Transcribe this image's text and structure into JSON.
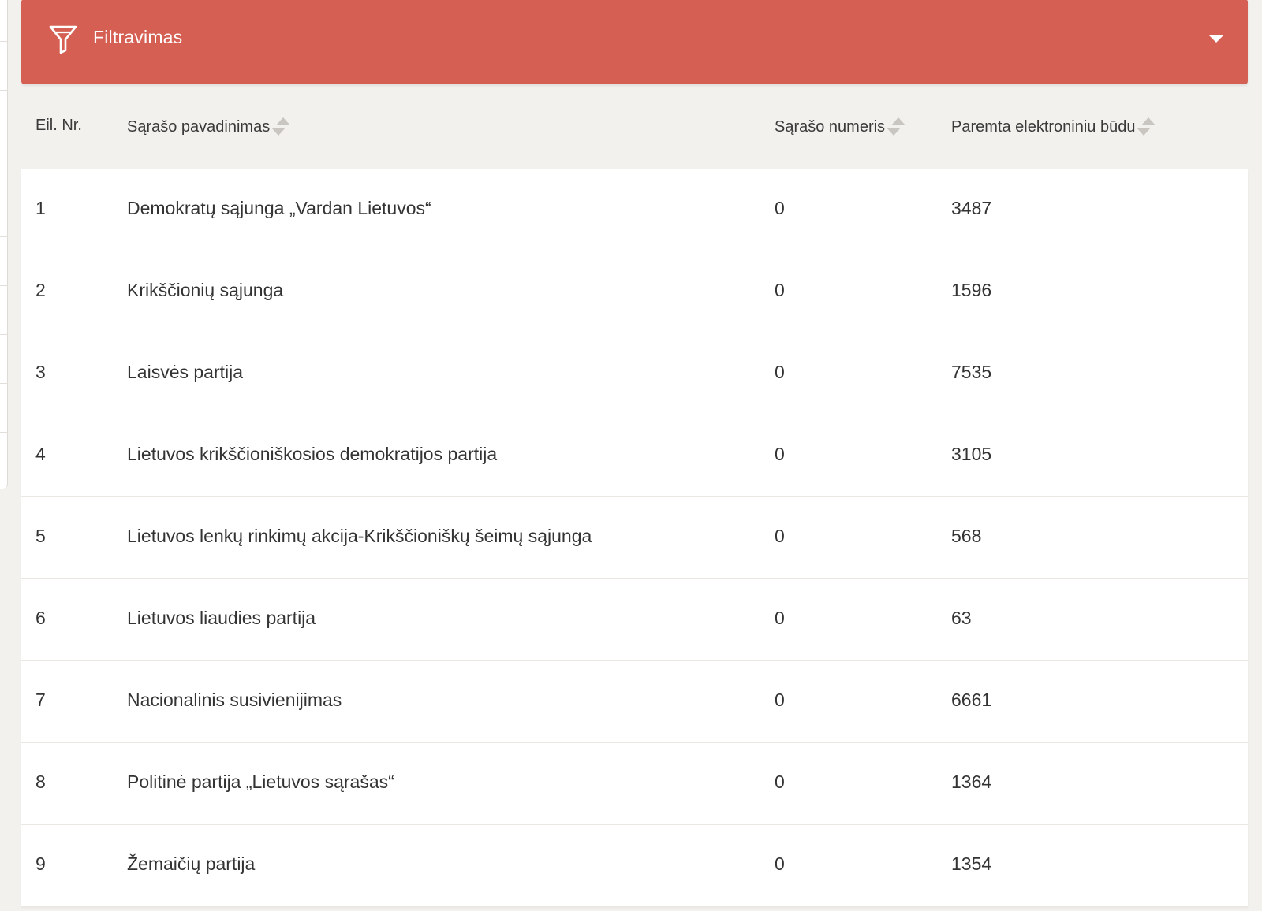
{
  "filter": {
    "label": "Filtravimas",
    "icon": "funnel-icon",
    "toggle_icon": "caret-down-icon",
    "color": "#d55f53"
  },
  "table": {
    "columns": [
      {
        "label": "Eil. Nr.",
        "sortable": false
      },
      {
        "label": "Sąrašo pavadinimas",
        "sortable": true
      },
      {
        "label": "Sąrašo numeris",
        "sortable": true
      },
      {
        "label": "Paremta elektroniniu būdu",
        "sortable": true
      }
    ],
    "rows": [
      {
        "nr": "1",
        "name": "Demokratų sąjunga „Vardan Lietuvos“",
        "number": "0",
        "supported": "3487"
      },
      {
        "nr": "2",
        "name": "Krikščionių sąjunga",
        "number": "0",
        "supported": "1596"
      },
      {
        "nr": "3",
        "name": "Laisvės partija",
        "number": "0",
        "supported": "7535"
      },
      {
        "nr": "4",
        "name": "Lietuvos krikščioniškosios demokratijos partija",
        "number": "0",
        "supported": "3105"
      },
      {
        "nr": "5",
        "name": "Lietuvos lenkų rinkimų akcija-Krikščioniškų šeimų sąjunga",
        "number": "0",
        "supported": "568"
      },
      {
        "nr": "6",
        "name": "Lietuvos liaudies partija",
        "number": "0",
        "supported": "63"
      },
      {
        "nr": "7",
        "name": "Nacionalinis susivienijimas",
        "number": "0",
        "supported": "6661"
      },
      {
        "nr": "8",
        "name": "Politinė partija „Lietuvos sąrašas“",
        "number": "0",
        "supported": "1364"
      },
      {
        "nr": "9",
        "name": "Žemaičių partija",
        "number": "0",
        "supported": "1354"
      }
    ]
  }
}
